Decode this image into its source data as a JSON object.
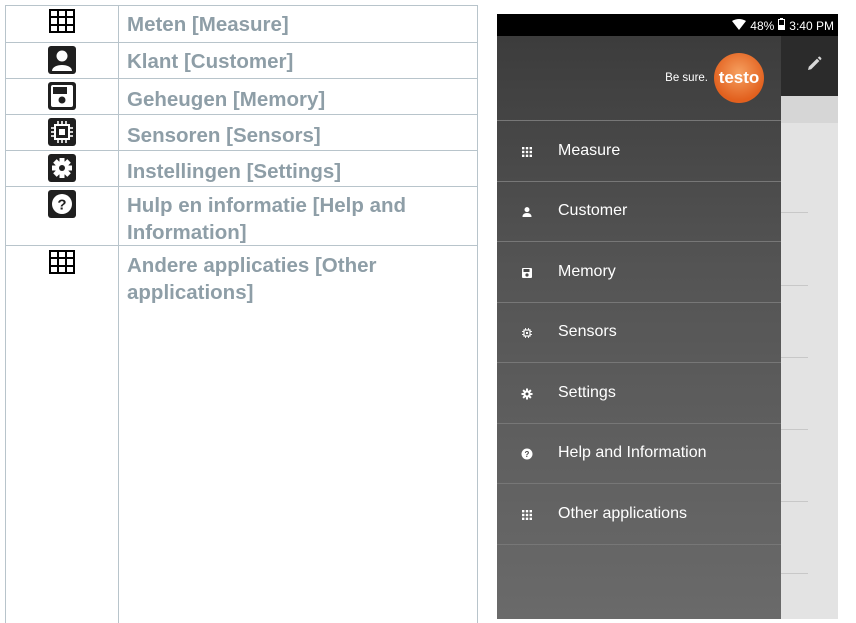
{
  "table": {
    "rows": [
      {
        "label": "Meten [Measure]",
        "icon": "grid-icon"
      },
      {
        "label": "Klant [Customer]",
        "icon": "person-icon"
      },
      {
        "label": "Geheugen [Memory]",
        "icon": "save-icon"
      },
      {
        "label": "Sensoren [Sensors]",
        "icon": "chip-icon"
      },
      {
        "label": "Instellingen [Settings]",
        "icon": "gear-icon"
      },
      {
        "label": "Hulp en informatie [Help and Information]",
        "icon": "help-icon"
      },
      {
        "label": "Andere applicaties [Other applications]",
        "icon": "grid-icon"
      }
    ]
  },
  "phone": {
    "status": {
      "battery": "48%",
      "time": "3:40 PM"
    },
    "logo": {
      "tagline": "Be sure.",
      "brand": "testo"
    },
    "menu": [
      {
        "label": "Measure",
        "icon": "apps-icon"
      },
      {
        "label": "Customer",
        "icon": "person-icon"
      },
      {
        "label": "Memory",
        "icon": "save-icon"
      },
      {
        "label": "Sensors",
        "icon": "chip-icon"
      },
      {
        "label": "Settings",
        "icon": "gear-icon"
      },
      {
        "label": "Help and Information",
        "icon": "help-icon"
      },
      {
        "label": "Other applications",
        "icon": "apps-icon"
      }
    ]
  },
  "colors": {
    "label_text": "#8e9ea7",
    "table_line": "#b8c4cb",
    "brand_orange": "#e2601e"
  }
}
